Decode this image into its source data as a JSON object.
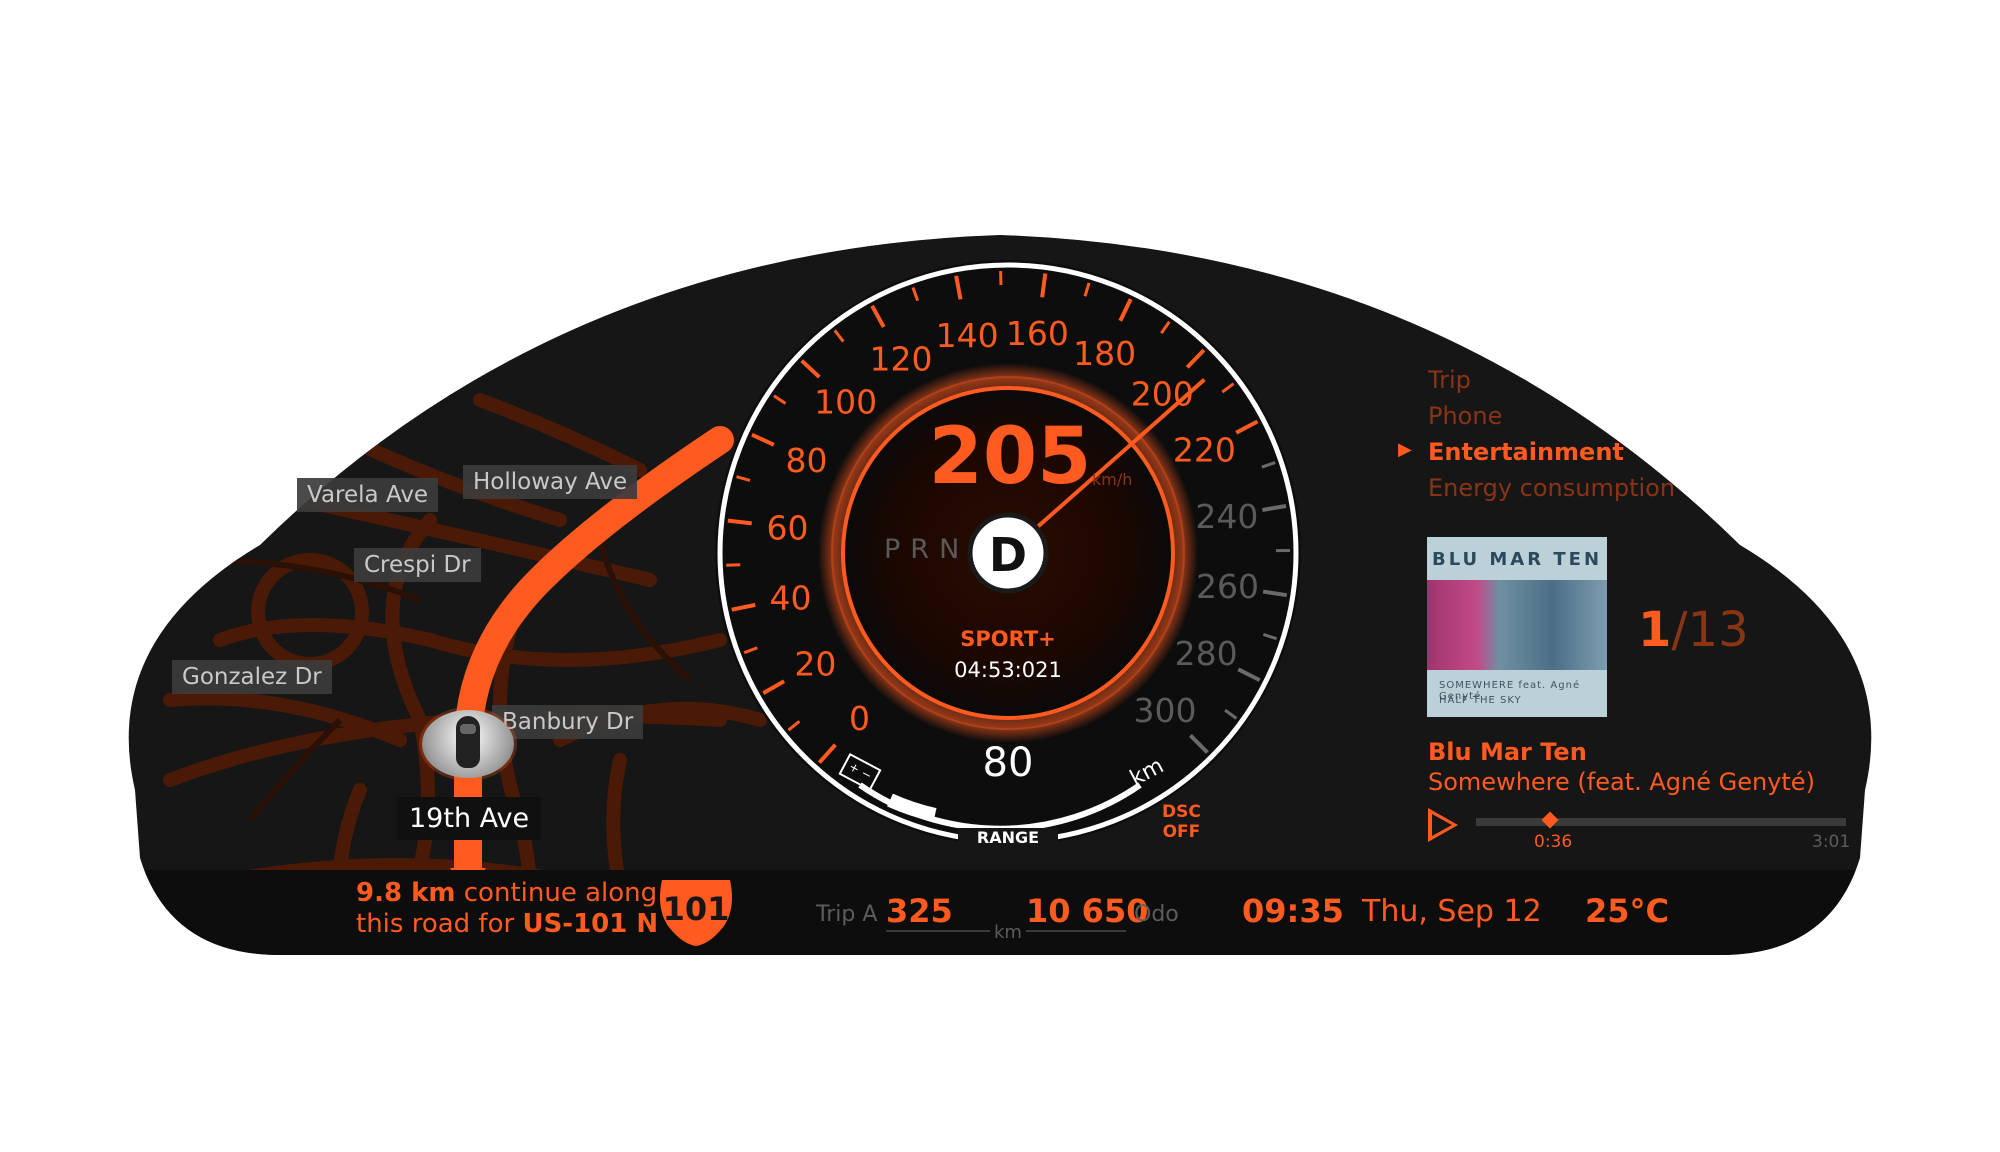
{
  "map": {
    "streets": [
      "Varela Ave",
      "Holloway Ave",
      "Crespi Dr",
      "Gonzalez Dr",
      "Banbury Dr"
    ],
    "current_street": "19th Ave"
  },
  "navigation": {
    "distance": "9.8 km",
    "instruction_line1": "continue along",
    "instruction_line2_prefix": "this road for",
    "route": "US-101 N",
    "shield_number": "101"
  },
  "speedometer": {
    "speed": "205",
    "unit": "km/h",
    "needle_value": 205,
    "max_value": 300,
    "labels": [
      "0",
      "20",
      "40",
      "60",
      "80",
      "100",
      "120",
      "140",
      "160",
      "180",
      "200",
      "220",
      "240",
      "260",
      "280",
      "300"
    ],
    "gears": [
      "P",
      "R",
      "N"
    ],
    "active_gear": "D",
    "mode": "SPORT+",
    "timer": "04:53:021",
    "range_value": "80",
    "range_unit": "km",
    "range_label": "RANGE",
    "range_fraction": 0.27,
    "dsc_line1": "DSC",
    "dsc_line2": "OFF"
  },
  "menu": {
    "items": [
      "Trip",
      "Phone",
      "Entertainment",
      "Energy consumption"
    ],
    "active_index": 2
  },
  "media": {
    "album_cover_title": "BLU MAR TEN",
    "album_cover_line1": "SOMEWHERE feat. Agné Genyté",
    "album_cover_line2": "HALF THE SKY",
    "track_index": "1",
    "track_total": "/13",
    "artist": "Blu Mar Ten",
    "track": "Somewhere (feat. Agné Genyté)",
    "elapsed": "0:36",
    "duration": "3:01",
    "progress_fraction": 0.2
  },
  "status_bar": {
    "trip_label": "Trip A",
    "trip_value": "325",
    "odo_value": "10 650",
    "odo_label": "Odo",
    "km_unit": "km",
    "time": "09:35",
    "date": "Thu, Sep 12",
    "temperature": "25°C"
  },
  "colors": {
    "accent": "#ff5a1f",
    "accent_dark": "#8a3416",
    "background": "#161616",
    "inactive_label": "#5c5c5c"
  }
}
